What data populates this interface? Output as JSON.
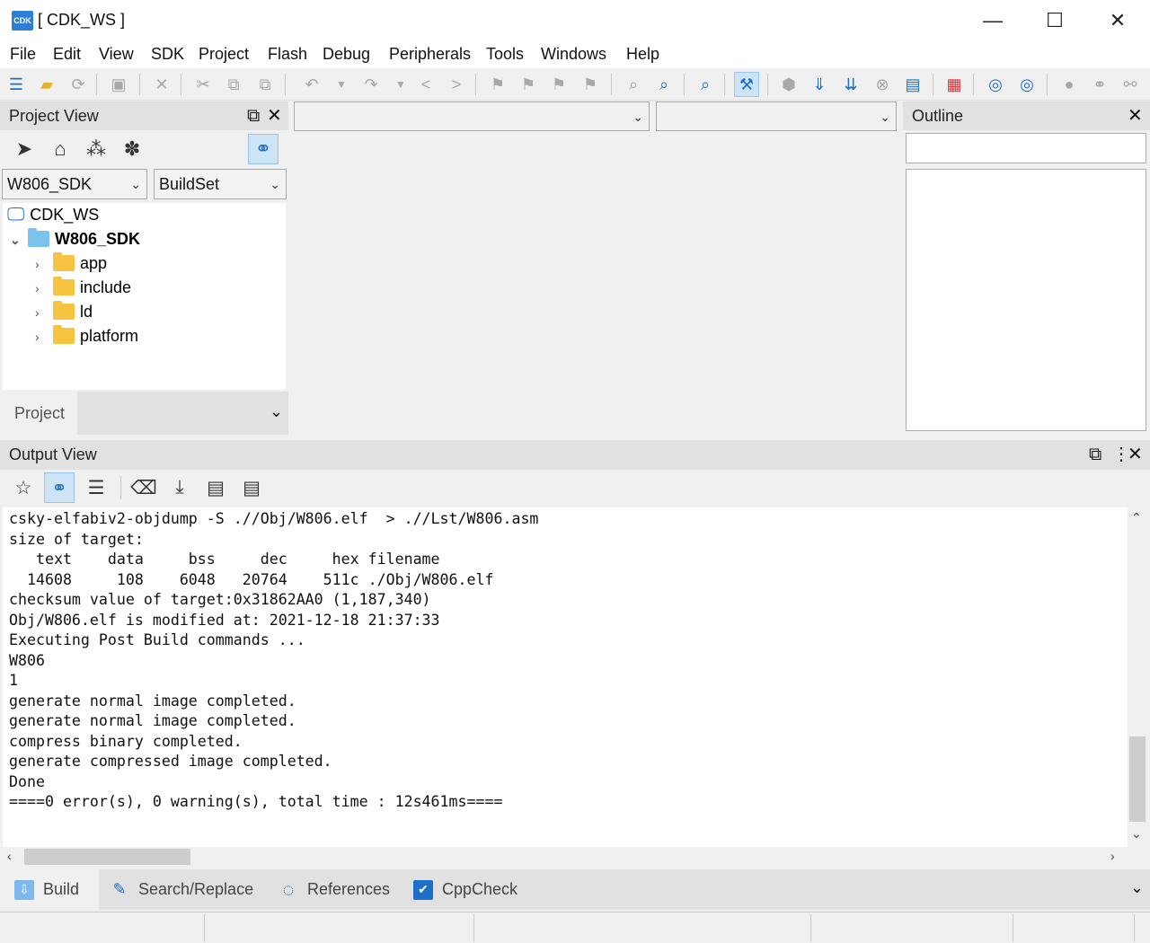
{
  "window": {
    "logo": "CDK",
    "title": "[ CDK_WS ]",
    "minimize": "—",
    "maximize": "☐",
    "close": "✕"
  },
  "menu": [
    "File",
    "Edit",
    "View",
    "SDK",
    "Project",
    "Flash",
    "Debug",
    "Peripherals",
    "Tools",
    "Windows",
    "Help"
  ],
  "project_view": {
    "title": "Project View",
    "sdk_select": "W806_SDK",
    "buildset_select": "BuildSet",
    "tree": {
      "workspace": "CDK_WS",
      "project": "W806_SDK",
      "folders": [
        "app",
        "include",
        "ld",
        "platform"
      ]
    },
    "bottom_tab": "Project"
  },
  "editor": {
    "combo1": "",
    "combo2": ""
  },
  "outline": {
    "title": "Outline",
    "search_value": ""
  },
  "output_view": {
    "title": "Output View",
    "console_lines": [
      "csky-elfabiv2-objdump -S .//Obj/W806.elf  > .//Lst/W806.asm",
      "size of target:",
      "   text    data     bss     dec     hex filename",
      "  14608     108    6048   20764    511c ./Obj/W806.elf",
      "checksum value of target:0x31862AA0 (1,187,340)",
      "Obj/W806.elf is modified at: 2021-12-18 21:37:33",
      "Executing Post Build commands ...",
      "W806",
      "1",
      "generate normal image completed.",
      "generate normal image completed.",
      "compress binary completed.",
      "generate compressed image completed.",
      "Done",
      "====0 error(s), 0 warning(s), total time : 12s461ms===="
    ],
    "tabs": [
      {
        "label": "Build",
        "icon": "build-icon"
      },
      {
        "label": "Search/Replace",
        "icon": "pencil-icon"
      },
      {
        "label": "References",
        "icon": "references-icon"
      },
      {
        "label": "CppCheck",
        "icon": "checkbox-icon"
      }
    ]
  }
}
